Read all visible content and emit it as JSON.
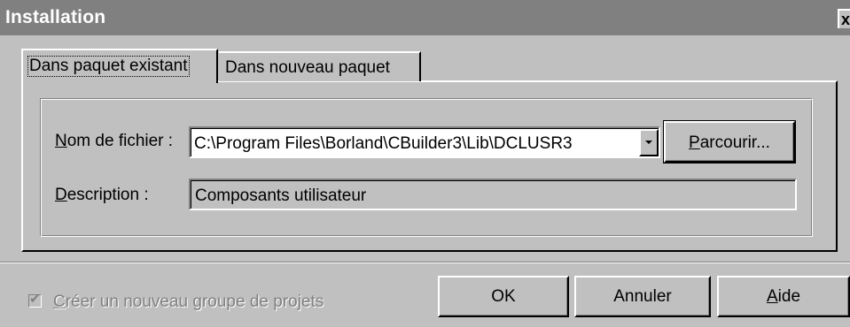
{
  "window": {
    "title": "Installation",
    "close_glyph": "x"
  },
  "tabs": [
    {
      "label": "Dans paquet existant",
      "active": true
    },
    {
      "label": "Dans nouveau paquet",
      "active": false
    }
  ],
  "form": {
    "filename_label_mnemonic": "N",
    "filename_label_rest": "om de fichier :",
    "filename_value": "C:\\Program Files\\Borland\\CBuilder3\\Lib\\DCLUSR3",
    "browse_mnemonic": "P",
    "browse_rest": "arcourir...",
    "description_label_mnemonic": "D",
    "description_label_rest": "escription :",
    "description_value": "Composants utilisateur"
  },
  "footer": {
    "checkbox_mnemonic": "C",
    "checkbox_rest": "réer un nouveau groupe de projets",
    "checkbox_checked": true,
    "checkbox_enabled": false,
    "ok_label": "OK",
    "cancel_label": "Annuler",
    "help_mnemonic": "A",
    "help_rest": "ide"
  },
  "icons": {
    "close": "close-icon",
    "dropdown": "chevron-down-icon",
    "check": "checkmark-icon"
  }
}
